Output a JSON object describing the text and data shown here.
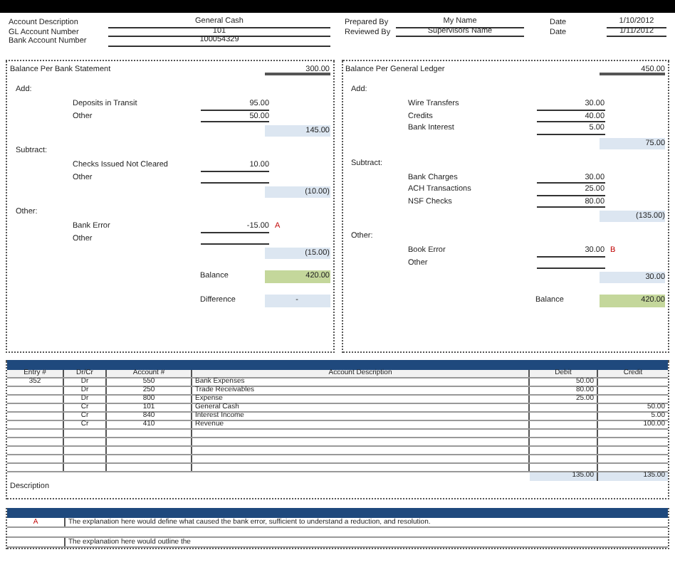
{
  "header": {
    "left": [
      {
        "label": "Account Description",
        "value": "General Cash"
      },
      {
        "label": "GL Account Number",
        "value": "101"
      },
      {
        "label": "Bank Account Number",
        "value": "100054329"
      }
    ],
    "right": [
      {
        "label": "Prepared By",
        "value": "My Name",
        "date_label": "Date",
        "date_value": "1/10/2012"
      },
      {
        "label": "Reviewed By",
        "value": "Supervisors Name",
        "date_label": "Date",
        "date_value": "1/11/2012"
      }
    ]
  },
  "bank": {
    "title": "Balance Per Bank Statement",
    "amount": "300.00",
    "sections": [
      {
        "label": "Add:",
        "items": [
          {
            "label": "Deposits in Transit",
            "amount": "95.00"
          },
          {
            "label": "Other",
            "amount": "50.00"
          }
        ],
        "total": "145.00"
      },
      {
        "label": "Subtract:",
        "items": [
          {
            "label": "Checks Issued Not Cleared",
            "amount": "10.00"
          },
          {
            "label": "Other"
          }
        ],
        "total": "(10.00)"
      },
      {
        "label": "Other:",
        "items": [
          {
            "label": "Bank Error",
            "amount": "-15.00",
            "marker": "A"
          },
          {
            "label": "Other"
          }
        ],
        "total": "(15.00)"
      }
    ],
    "results": [
      {
        "kind": "balance",
        "label": "Balance",
        "value": "420.00"
      },
      {
        "kind": "difference",
        "label": "Difference",
        "value": "-"
      }
    ]
  },
  "ledger": {
    "title": "Balance Per General Ledger",
    "amount": "450.00",
    "sections": [
      {
        "label": "Add:",
        "items": [
          {
            "label": "Wire Transfers",
            "amount": "30.00"
          },
          {
            "label": "Credits",
            "amount": "40.00"
          },
          {
            "label": "Bank Interest",
            "amount": "5.00"
          }
        ],
        "total": "75.00"
      },
      {
        "label": "Subtract:",
        "items": [
          {
            "label": "Bank Charges",
            "amount": "30.00"
          },
          {
            "label": "ACH Transactions",
            "amount": "25.00"
          },
          {
            "label": "NSF Checks",
            "amount": "80.00"
          }
        ],
        "total": "(135.00)"
      },
      {
        "label": "Other:",
        "items": [
          {
            "label": "Book Error",
            "amount": "30.00",
            "marker": "B"
          },
          {
            "label": "Other"
          }
        ],
        "total": "30.00"
      }
    ],
    "results": [
      {
        "kind": "balance",
        "label": "Balance",
        "value": "420.00"
      }
    ]
  },
  "journal": {
    "columns": [
      "Entry #",
      "Dr/Cr",
      "Account #",
      "Account Description",
      "Debit",
      "Credit"
    ],
    "rows": [
      [
        "352",
        "Dr",
        "550",
        "Bank Expenses",
        "50.00",
        ""
      ],
      [
        "",
        "Dr",
        "250",
        "Trade Receivables",
        "80.00",
        ""
      ],
      [
        "",
        "Dr",
        "800",
        "Expense",
        "25.00",
        ""
      ],
      [
        "",
        "Cr",
        "101",
        "General Cash",
        "",
        "50.00"
      ],
      [
        "",
        "Cr",
        "840",
        "Interest Income",
        "",
        "5.00"
      ],
      [
        "",
        "Cr",
        "410",
        "Revenue",
        "",
        "100.00"
      ]
    ],
    "totals": {
      "debit": "135.00",
      "credit": "135.00"
    },
    "description_label": "Description"
  },
  "notes": [
    {
      "marker": "A",
      "text": "The explanation here would define what caused the bank error, sufficient to understand a reduction, and resolution."
    },
    {
      "text": "The explanation here would outline the"
    }
  ]
}
